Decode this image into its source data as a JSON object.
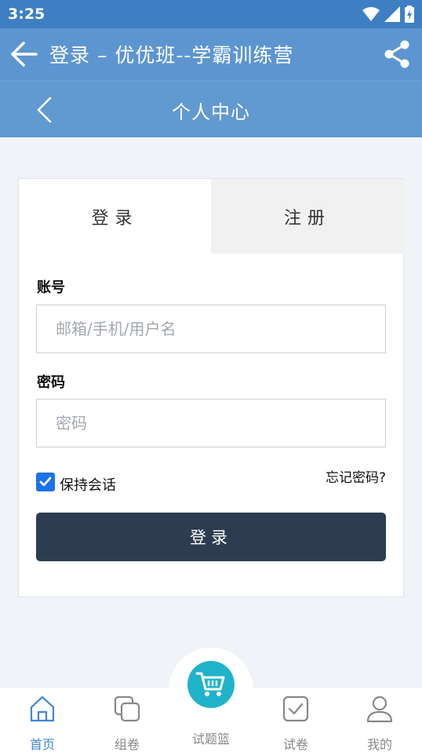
{
  "status_bar": {
    "time": "3:25"
  },
  "app_bar": {
    "title": "登录 – 优优班--学霸训练营"
  },
  "sub_header": {
    "title": "个人中心"
  },
  "tabs": {
    "login": "登录",
    "register": "注册"
  },
  "form": {
    "account_label": "账号",
    "account_placeholder": "邮箱/手机/用户名",
    "account_value": "",
    "password_label": "密码",
    "password_placeholder": "密码",
    "password_value": "",
    "remember_label": "保持会话",
    "remember_checked": true,
    "forgot_label": "忘记密码?",
    "submit_label": "登录"
  },
  "bottom_nav": {
    "items": [
      {
        "label": "首页",
        "icon": "home-icon",
        "active": true
      },
      {
        "label": "组卷",
        "icon": "layers-icon",
        "active": false
      },
      {
        "label": "试题篮",
        "icon": "cart-icon",
        "active": false
      },
      {
        "label": "试卷",
        "icon": "checkbox-icon",
        "active": false
      },
      {
        "label": "我的",
        "icon": "user-icon",
        "active": false
      }
    ]
  },
  "colors": {
    "status_bar": "#3e7fc3",
    "app_bar": "#5d95d1",
    "sub_header": "#6199d1",
    "primary_button": "#2d3c50",
    "cart_accent": "#1fb3c9",
    "active_nav": "#3d86d6"
  }
}
